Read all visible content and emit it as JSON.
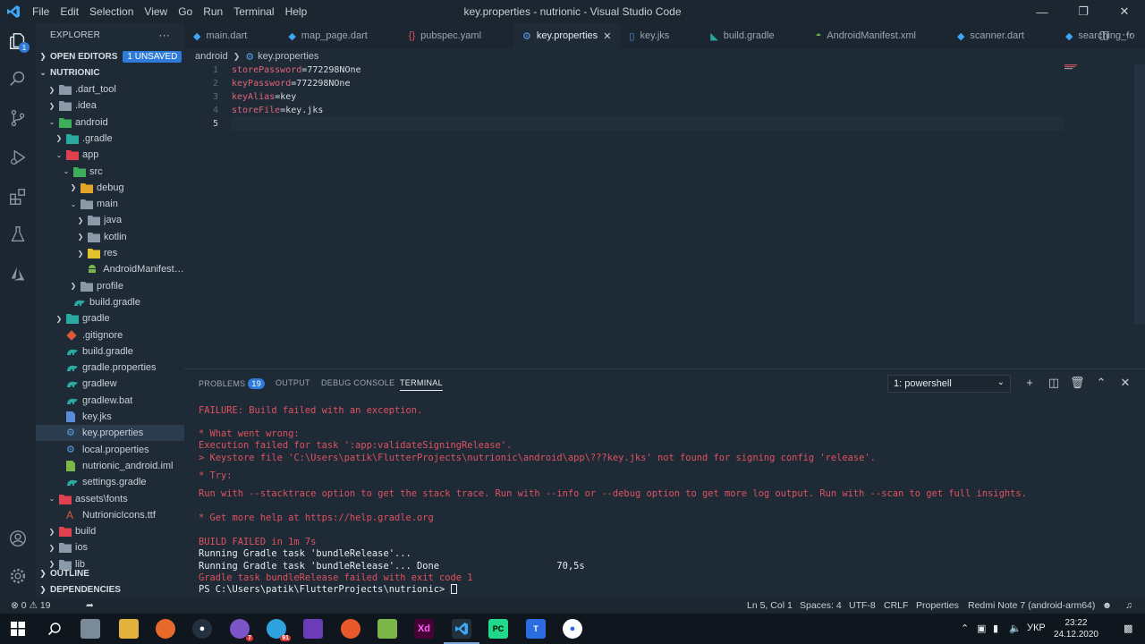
{
  "titlebar": {
    "menu": [
      "File",
      "Edit",
      "Selection",
      "View",
      "Go",
      "Run",
      "Terminal",
      "Help"
    ],
    "title": "key.properties - nutrionic - Visual Studio Code"
  },
  "activitybar": {
    "explorer_badge": "1"
  },
  "sidebar": {
    "header": "EXPLORER",
    "more": "···",
    "open_editors": "OPEN EDITORS",
    "unsaved_badge": "1 UNSAVED",
    "root": "NUTRIONIC",
    "items": [
      {
        "label": ".dart_tool",
        "color": "#8a9aa8"
      },
      {
        "label": ".idea",
        "color": "#8a9aa8"
      },
      {
        "label": "android",
        "color": "#3fae5a"
      },
      {
        "label": ".gradle",
        "color": "#2aa9a0"
      },
      {
        "label": "app",
        "color": "#e0404f"
      },
      {
        "label": "src",
        "color": "#3fae5a"
      },
      {
        "label": "debug",
        "color": "#e3a52a"
      },
      {
        "label": "main",
        "color": "#8a9aa8"
      },
      {
        "label": "java",
        "color": "#8a9aa8"
      },
      {
        "label": "kotlin",
        "color": "#8a9aa8"
      },
      {
        "label": "res",
        "color": "#e3c22a"
      },
      {
        "label": "AndroidManifest....",
        "color": "#7ab648"
      },
      {
        "label": "profile",
        "color": "#8a9aa8"
      },
      {
        "label": "build.gradle",
        "color": "#2aa9a0"
      },
      {
        "label": "gradle",
        "color": "#2aa9a0"
      },
      {
        "label": ".gitignore",
        "color": "#e05a3a"
      },
      {
        "label": "build.gradle",
        "color": "#2aa9a0"
      },
      {
        "label": "gradle.properties",
        "color": "#2aa9a0"
      },
      {
        "label": "gradlew",
        "color": "#2aa9a0"
      },
      {
        "label": "gradlew.bat",
        "color": "#2aa9a0"
      },
      {
        "label": "key.jks",
        "color": "#5a8ad8"
      },
      {
        "label": "key.properties",
        "color": "#5aa0e8"
      },
      {
        "label": "local.properties",
        "color": "#5aa0e8"
      },
      {
        "label": "nutrionic_android.iml",
        "color": "#7ab648"
      },
      {
        "label": "settings.gradle",
        "color": "#2aa9a0"
      },
      {
        "label": "assets\\fonts",
        "color": "#e0404f"
      },
      {
        "label": "NutrionicIcons.ttf",
        "color": "#e05a3a"
      },
      {
        "label": "build",
        "color": "#e0404f"
      },
      {
        "label": "ios",
        "color": "#8a9aa8"
      },
      {
        "label": "lib",
        "color": "#8a9aa8"
      }
    ],
    "outline": "OUTLINE",
    "dependencies": "DEPENDENCIES"
  },
  "tabs": [
    {
      "label": "main.dart",
      "icon": "dart-icon"
    },
    {
      "label": "map_page.dart",
      "icon": "dart-icon"
    },
    {
      "label": "pubspec.yaml",
      "icon": "braces-icon"
    },
    {
      "label": "key.properties",
      "icon": "gear-icon",
      "active": true
    },
    {
      "label": "key.jks",
      "icon": "file-icon"
    },
    {
      "label": "build.gradle",
      "icon": "elephant-icon"
    },
    {
      "label": "AndroidManifest.xml",
      "icon": "android-icon"
    },
    {
      "label": "scanner.dart",
      "icon": "dart-icon"
    },
    {
      "label": "searching_fo",
      "icon": "dart-icon"
    }
  ],
  "breadcrumb": {
    "folder": "android",
    "file": "key.properties"
  },
  "editor": {
    "lines": [
      {
        "n": "1",
        "key": "storePassword",
        "value": "772298NOne"
      },
      {
        "n": "2",
        "key": "keyPassword",
        "value": "772298NOne"
      },
      {
        "n": "3",
        "key": "keyAlias",
        "value": "key"
      },
      {
        "n": "4",
        "key": "storeFile",
        "value": "key.jks"
      },
      {
        "n": "5",
        "key": "",
        "value": ""
      }
    ]
  },
  "panel": {
    "tabs": {
      "problems": "PROBLEMS",
      "problems_count": "19",
      "output": "OUTPUT",
      "debug": "DEBUG CONSOLE",
      "terminal": "TERMINAL"
    },
    "terminal_select": "1: powershell",
    "terminal": [
      {
        "text": "FAILURE: Build failed with an exception.",
        "color": "red"
      },
      {
        "text": "* What went wrong:",
        "color": "red"
      },
      {
        "text": "Execution failed for task ':app:validateSigningRelease'.",
        "color": "red"
      },
      {
        "text": "> Keystore file 'C:\\Users\\patik\\FlutterProjects\\nutrionic\\android\\app\\???key.jks' not found for signing config 'release'.",
        "color": "red"
      },
      {
        "text": "* Try:",
        "color": "red"
      },
      {
        "text": "Run with --stacktrace option to get the stack trace. Run with --info or --debug option to get more log output. Run with --scan to get full insights.",
        "color": "red"
      },
      {
        "text": "* Get more help at https://help.gradle.org",
        "color": "red"
      },
      {
        "text": "BUILD FAILED in 1m 7s",
        "color": "red"
      },
      {
        "text": "Running Gradle task 'bundleRelease'...",
        "color": "white"
      },
      {
        "text": "Running Gradle task 'bundleRelease'... Done                     70,5s",
        "color": "white"
      },
      {
        "text": "Gradle task bundleRelease failed with exit code 1",
        "color": "red"
      },
      {
        "text": "PS C:\\Users\\patik\\FlutterProjects\\nutrionic> ",
        "color": "white"
      }
    ]
  },
  "statusbar": {
    "errors": "0",
    "warnings": "19",
    "position": "Ln 5, Col 1",
    "spaces": "Spaces: 4",
    "encoding": "UTF-8",
    "eol": "CRLF",
    "language": "Properties",
    "device": "Redmi Note 7 (android-arm64)"
  },
  "taskbar": {
    "telegram_badge": "91",
    "viber_badge": "7",
    "lang": "УКР",
    "time": "23:22",
    "date": "24.12.2020"
  }
}
